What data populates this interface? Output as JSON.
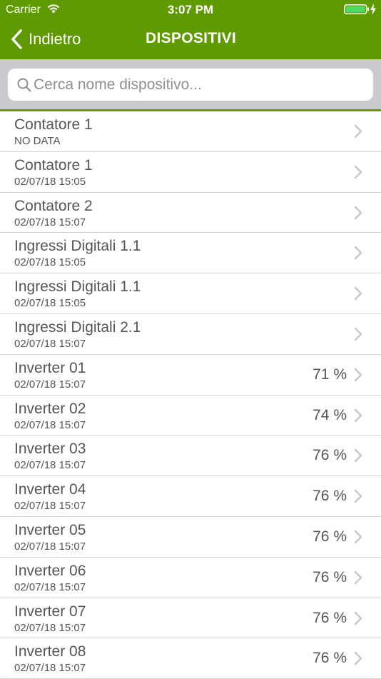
{
  "status_bar": {
    "carrier": "Carrier",
    "time": "3:07 PM"
  },
  "nav": {
    "back_label": "Indietro",
    "title": "DISPOSITIVI"
  },
  "search": {
    "placeholder": "Cerca nome dispositivo..."
  },
  "colors": {
    "brand": "#5f9b00",
    "search_bg": "#c9c9ce",
    "battery": "#4cd964"
  },
  "icons": {
    "back": "chevron-left-icon",
    "search": "magnifier-icon",
    "row": "chevron-right-icon"
  },
  "devices": [
    {
      "name": "Contatore 1",
      "sub": "NO DATA",
      "value": ""
    },
    {
      "name": "Contatore 1",
      "sub": "02/07/18 15:05",
      "value": ""
    },
    {
      "name": "Contatore 2",
      "sub": "02/07/18 15:07",
      "value": ""
    },
    {
      "name": "Ingressi Digitali 1.1",
      "sub": "02/07/18 15:05",
      "value": ""
    },
    {
      "name": "Ingressi Digitali 1.1",
      "sub": "02/07/18 15:05",
      "value": ""
    },
    {
      "name": "Ingressi Digitali 2.1",
      "sub": "02/07/18 15:07",
      "value": ""
    },
    {
      "name": "Inverter 01",
      "sub": "02/07/18 15:07",
      "value": "71 %"
    },
    {
      "name": "Inverter 02",
      "sub": "02/07/18 15:07",
      "value": "74 %"
    },
    {
      "name": "Inverter 03",
      "sub": "02/07/18 15:07",
      "value": "76 %"
    },
    {
      "name": "Inverter 04",
      "sub": "02/07/18 15:07",
      "value": "76 %"
    },
    {
      "name": "Inverter 05",
      "sub": "02/07/18 15:07",
      "value": "76 %"
    },
    {
      "name": "Inverter 06",
      "sub": "02/07/18 15:07",
      "value": "76 %"
    },
    {
      "name": "Inverter 07",
      "sub": "02/07/18 15:07",
      "value": "76 %"
    },
    {
      "name": "Inverter 08",
      "sub": "02/07/18 15:07",
      "value": "76 %"
    }
  ]
}
